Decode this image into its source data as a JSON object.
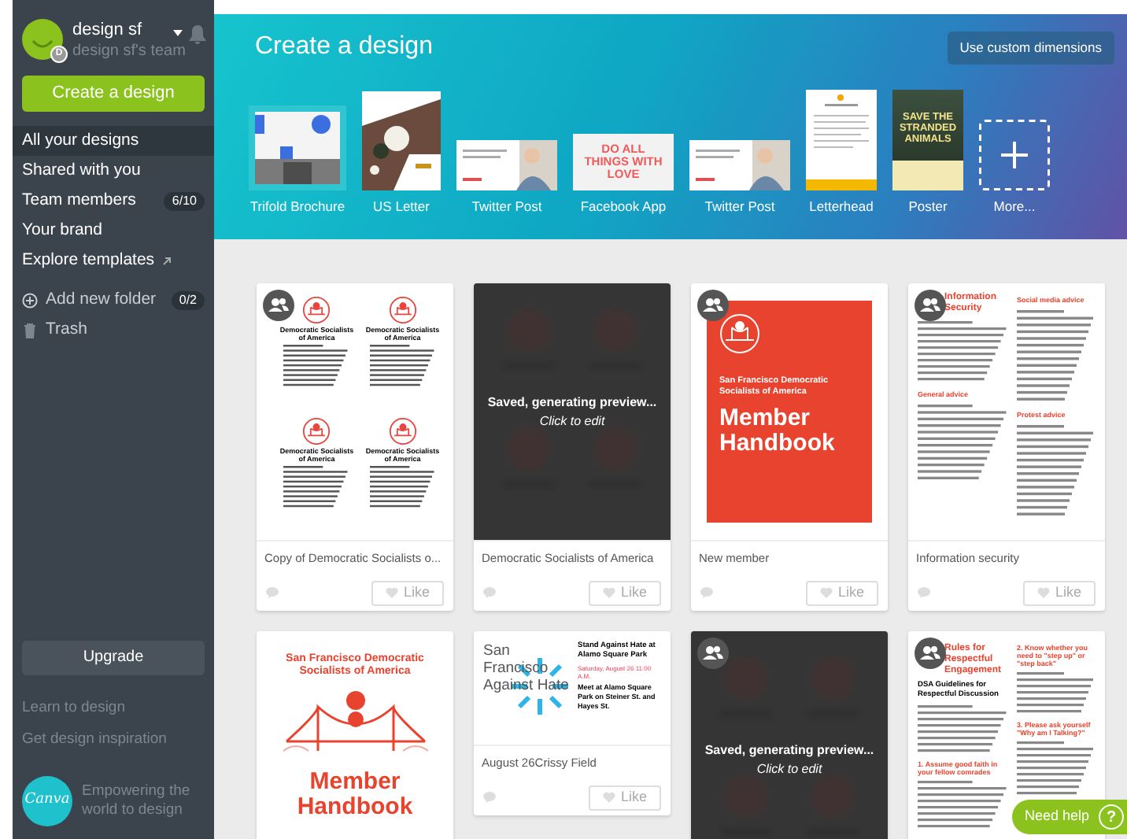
{
  "sidebar": {
    "user": {
      "name": "design sf",
      "team": "design sf's team",
      "badge": "D"
    },
    "create_button": "Create a design",
    "nav": [
      {
        "label": "All your designs",
        "selected": true,
        "external": false
      },
      {
        "label": "Shared with you",
        "selected": false,
        "external": false
      },
      {
        "label": "Team members",
        "selected": false,
        "external": false,
        "count": "6/10"
      },
      {
        "label": "Your brand",
        "selected": false,
        "external": false
      },
      {
        "label": "Explore templates",
        "selected": false,
        "external": true
      }
    ],
    "folders": [
      {
        "kind": "add",
        "label": "Add new folder",
        "count": "0/2"
      },
      {
        "kind": "trash",
        "label": "Trash"
      }
    ],
    "upgrade_button": "Upgrade",
    "links": [
      "Learn to design",
      "Get design inspiration"
    ],
    "logo": "Canva",
    "tagline": "Empowering the world to design"
  },
  "banner": {
    "title": "Create a design",
    "custom_button": "Use custom dimensions",
    "templates": [
      {
        "label": "Trifold Brochure",
        "kind": "brochure"
      },
      {
        "label": "US Letter",
        "kind": "letter"
      },
      {
        "label": "Twitter Post",
        "kind": "twitter"
      },
      {
        "label": "Facebook App",
        "kind": "facebook",
        "text": "DO ALL THINGS WITH LOVE"
      },
      {
        "label": "Twitter Post",
        "kind": "twitter"
      },
      {
        "label": "Letterhead",
        "kind": "letterhead"
      },
      {
        "label": "Poster",
        "kind": "poster",
        "text": "SAVE THE STRANDED ANIMALS"
      },
      {
        "label": "More...",
        "kind": "more"
      }
    ]
  },
  "cards": [
    {
      "title": "Copy of Democratic Socialists o...",
      "shared": true,
      "generating": false,
      "like": "Like",
      "thumb": {
        "kind": "flyer",
        "headings": [
          "Democratic Socialists of America",
          "Democratic Socialists of America",
          "Democratic Socialists of America",
          "Democratic Socialists of America"
        ]
      }
    },
    {
      "title": "Democratic Socialists of America",
      "shared": false,
      "generating": true,
      "overlay": "Saved, generating preview...",
      "overlay_hint": "Click to edit",
      "like": "Like",
      "thumb": {
        "kind": "blurred"
      }
    },
    {
      "title": "New member",
      "shared": true,
      "generating": false,
      "like": "Like",
      "thumb": {
        "kind": "cover",
        "subtitle": "San Francisco Democratic Socialists of America",
        "heading": "Member Handbook"
      }
    },
    {
      "title": "Information security",
      "shared": true,
      "generating": false,
      "like": "Like",
      "thumb": {
        "kind": "article",
        "heading": "Information Security",
        "sections": [
          "General advice",
          "Social media advice",
          "Protest advice"
        ]
      }
    },
    {
      "shared": false,
      "generating": false,
      "thumb": {
        "kind": "handbook",
        "subtitle": "San Francisco Democratic Socialists of America",
        "heading": "Member Handbook"
      }
    },
    {
      "title": "August 26Crissy Field",
      "shared": false,
      "generating": false,
      "like": "Like",
      "thumb": {
        "kind": "event",
        "logo": "San Francisco Against Hate",
        "heading": "Stand Against Hate at Alamo Square Park",
        "date": "Saturday, August 26 11:00 A.M.",
        "details": "Meet at Alamo Square Park on Steiner St. and Hayes St."
      }
    },
    {
      "shared": true,
      "generating": true,
      "overlay": "Saved, generating preview...",
      "overlay_hint": "Click to edit",
      "thumb": {
        "kind": "blurred"
      }
    },
    {
      "shared": true,
      "generating": false,
      "thumb": {
        "kind": "guide",
        "heading": "Rules for Respectful Engagement",
        "subtitle": "DSA Guidelines for Respectful Discussion",
        "sections": [
          "1. Assume good faith in your fellow comrades",
          "2. Know whether you need to \"step up\" or \"step back\"",
          "3. Please ask yourself \"Why am I Talking?\""
        ]
      }
    }
  ],
  "help": {
    "label": "Need help",
    "icon": "?"
  }
}
